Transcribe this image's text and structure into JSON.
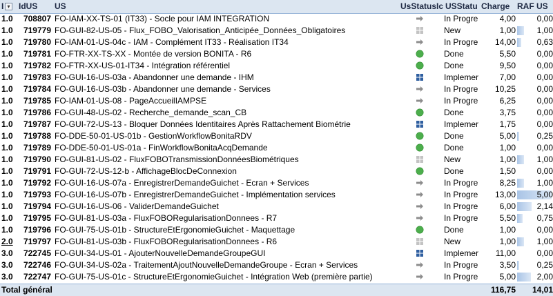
{
  "header": {
    "level": "I",
    "id": "IdUS",
    "us": "US",
    "statusicon": "UsStatusIc",
    "status": "USStatu",
    "charge": "Charge",
    "raf": "RAF US"
  },
  "rows": [
    {
      "level": "1.0",
      "id": "708807",
      "us": "FO-IAM-XX-TS-01 (IT33) - Socle pour IAM INTEGRATION",
      "icon": "arrow-icon",
      "status": "In Progre",
      "charge": "4,00",
      "raf": "0,00",
      "raf_value": 0.0
    },
    {
      "level": "1.0",
      "id": "719779",
      "us": "FO-GUI-82-US-05 - Flux_FOBO_Valorisation_Anticipée_Données_Obligatoires",
      "icon": "grid-grey-icon",
      "status": "New",
      "charge": "1,00",
      "raf": "1,00",
      "raf_value": 1.0
    },
    {
      "level": "1.0",
      "id": "719780",
      "us": "FO-IAM-01-US-04c - IAM - Complément IT33 - Réalisation IT34",
      "icon": "arrow-icon",
      "status": "In Progre",
      "charge": "14,00",
      "raf": "0,63",
      "raf_value": 0.63
    },
    {
      "level": "1.0",
      "id": "719781",
      "us": "FO-FTR-XX-TS-XX - Montée de version BONITA - R6",
      "icon": "green-circle-icon",
      "status": "Done",
      "charge": "5,50",
      "raf": "0,00",
      "raf_value": 0.0
    },
    {
      "level": "1.0",
      "id": "719782",
      "us": "FO-FTR-XX-US-01-IT34 - Intégration référentiel",
      "icon": "green-circle-icon",
      "status": "Done",
      "charge": "9,50",
      "raf": "0,00",
      "raf_value": 0.0
    },
    {
      "level": "1.0",
      "id": "719783",
      "us": "FO-GUI-16-US-03a - Abandonner une demande - IHM",
      "icon": "grid-blue-icon",
      "status": "Implemer",
      "charge": "7,00",
      "raf": "0,00",
      "raf_value": 0.0
    },
    {
      "level": "1.0",
      "id": "719784",
      "us": "FO-GUI-16-US-03b - Abandonner une demande - Services",
      "icon": "arrow-icon",
      "status": "In Progre",
      "charge": "10,25",
      "raf": "0,00",
      "raf_value": 0.0
    },
    {
      "level": "1.0",
      "id": "719785",
      "us": "FO-IAM-01-US-08 - PageAccueilIAMPSE",
      "icon": "arrow-icon",
      "status": "In Progre",
      "charge": "6,25",
      "raf": "0,00",
      "raf_value": 0.0
    },
    {
      "level": "1.0",
      "id": "719786",
      "us": "FO-GUI-48-US-02 - Recherche_demande_scan_CB",
      "icon": "green-circle-icon",
      "status": "Done",
      "charge": "3,75",
      "raf": "0,00",
      "raf_value": 0.0
    },
    {
      "level": "1.0",
      "id": "719787",
      "us": "FO-GUI-72-US-13 - Bloquer Données Identitaires Après Rattachement Biométrie",
      "icon": "grid-blue-icon",
      "status": "Implemer",
      "charge": "1,75",
      "raf": "0,00",
      "raf_value": 0.0
    },
    {
      "level": "1.0",
      "id": "719788",
      "us": "FO-DDE-50-01-US-01b - GestionWorkflowBonitaRDV",
      "icon": "green-circle-icon",
      "status": "Done",
      "charge": "5,00",
      "raf": "0,25",
      "raf_value": 0.25
    },
    {
      "level": "1.0",
      "id": "719789",
      "us": "FO-DDE-50-01-US-01a - FinWorkflowBonitaAcqDemande",
      "icon": "green-circle-icon",
      "status": "Done",
      "charge": "1,00",
      "raf": "0,00",
      "raf_value": 0.0
    },
    {
      "level": "1.0",
      "id": "719790",
      "us": "FO-GUI-81-US-02 - FluxFOBOTransmissionDonnéesBiométriques",
      "icon": "grid-grey-icon",
      "status": "New",
      "charge": "1,00",
      "raf": "1,00",
      "raf_value": 1.0
    },
    {
      "level": "1.0",
      "id": "719791",
      "us": "FO-GUI-72-US-12-b - AffichageBlocDeConnexion",
      "icon": "green-circle-icon",
      "status": "Done",
      "charge": "1,50",
      "raf": "0,00",
      "raf_value": 0.0
    },
    {
      "level": "1.0",
      "id": "719792",
      "us": "FO-GUI-16-US-07a - EnregistrerDemandeGuichet - Ecran + Services",
      "icon": "arrow-icon",
      "status": "In Progre",
      "charge": "8,25",
      "raf": "1,00",
      "raf_value": 1.0
    },
    {
      "level": "1.0",
      "id": "719793",
      "us": "FO-GUI-16-US-07b - EnregistrerDemandeGuichet - Implémentation services",
      "icon": "arrow-icon",
      "status": "In Progre",
      "charge": "13,00",
      "raf": "5,00",
      "raf_value": 5.0
    },
    {
      "level": "1.0",
      "id": "719794",
      "us": "FO-GUI-16-US-06 - ValiderDemandeGuichet",
      "icon": "arrow-icon",
      "status": "In Progre",
      "charge": "6,00",
      "raf": "2,14",
      "raf_value": 2.14
    },
    {
      "level": "1.0",
      "id": "719795",
      "us": "FO-GUI-81-US-03a - FluxFOBORegularisationDonnees - R7",
      "icon": "arrow-icon",
      "status": "In Progre",
      "charge": "5,50",
      "raf": "0,75",
      "raf_value": 0.75
    },
    {
      "level": "1.0",
      "id": "719796",
      "us": "FO-GUI-75-US-01b - StructureEtErgonomieGuichet - Maquettage",
      "icon": "green-circle-icon",
      "status": "Done",
      "charge": "1,00",
      "raf": "0,00",
      "raf_value": 0.0
    },
    {
      "level": "2.0",
      "id": "719797",
      "us": "FO-GUI-81-US-03b - FluxFOBORegularisationDonnees - R6",
      "icon": "grid-grey-icon",
      "status": "New",
      "charge": "1,00",
      "raf": "1,00",
      "raf_value": 1.0
    },
    {
      "level": "3.0",
      "id": "722745",
      "us": "FO-GUI-34-US-01 - AjouterNouvelleDemandeGroupeGUI",
      "icon": "grid-blue-icon",
      "status": "Implemer",
      "charge": "11,00",
      "raf": "0,00",
      "raf_value": 0.0
    },
    {
      "level": "3.0",
      "id": "722746",
      "us": "FO-GUI-34-US-02a - TraitementAjoutNouvelleDemandeGroupe - Ecran + Services",
      "icon": "arrow-icon",
      "status": "In Progre",
      "charge": "3,50",
      "raf": "0,25",
      "raf_value": 0.25
    },
    {
      "level": "3.0",
      "id": "722747",
      "us": "FO-GUI-75-US-01c - StructureEtErgonomieGuichet - Intégration Web (première partie)",
      "icon": "arrow-icon",
      "status": "In Progre",
      "charge": "5,00",
      "raf": "2,00",
      "raf_value": 2.0
    }
  ],
  "total": {
    "label": "Total général",
    "charge": "116,75",
    "raf": "14,01"
  },
  "colors": {
    "header_bg": "#dce6f1",
    "databar": "#a9c4e6",
    "done_green": "#4cae4c",
    "grid_blue": "#2f5fa0"
  }
}
